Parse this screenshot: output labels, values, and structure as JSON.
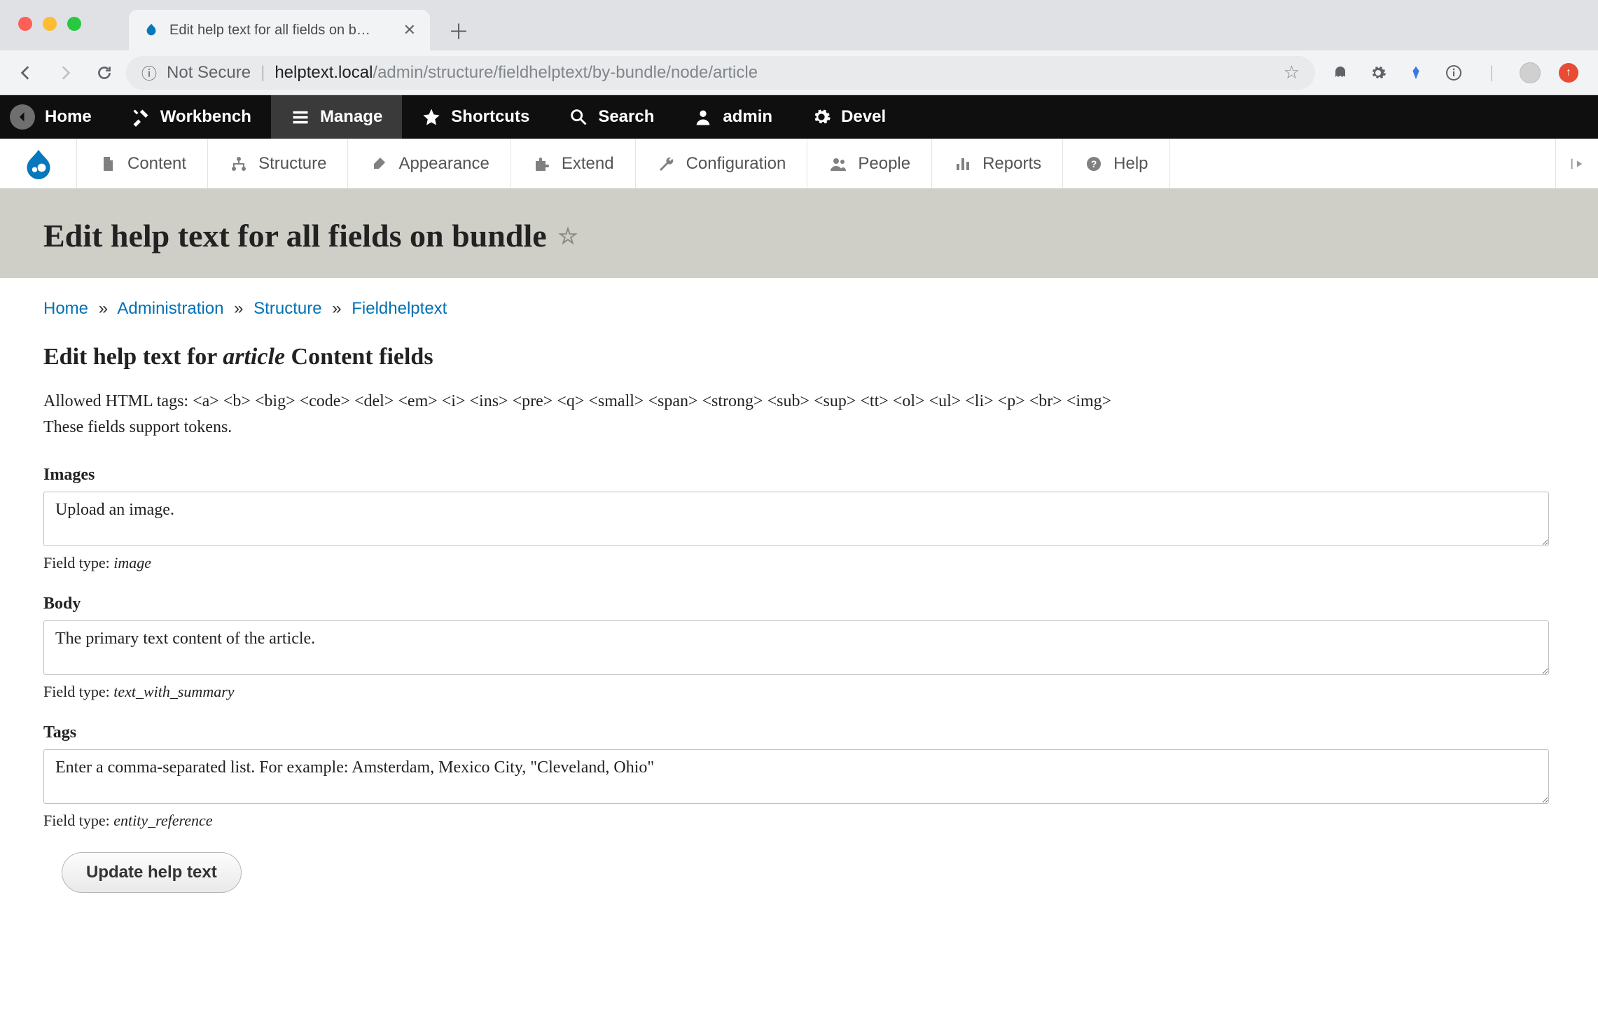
{
  "browser": {
    "tab_title": "Edit help text for all fields on b…",
    "not_secure_label": "Not Secure",
    "url_host": "helptext.local",
    "url_path": "/admin/structure/fieldhelptext/by-bundle/node/article"
  },
  "black_bar": {
    "home": "Home",
    "workbench": "Workbench",
    "manage": "Manage",
    "shortcuts": "Shortcuts",
    "search": "Search",
    "user": "admin",
    "devel": "Devel"
  },
  "white_bar": {
    "content": "Content",
    "structure": "Structure",
    "appearance": "Appearance",
    "extend": "Extend",
    "configuration": "Configuration",
    "people": "People",
    "reports": "Reports",
    "help": "Help"
  },
  "page_title": "Edit help text for all fields on bundle",
  "breadcrumb": {
    "home": "Home",
    "administration": "Administration",
    "structure": "Structure",
    "fieldhelptext": "Fieldhelptext"
  },
  "subheading": {
    "prefix": "Edit help text for ",
    "em": "article",
    "suffix": " Content fields"
  },
  "intro": {
    "line1": "Allowed HTML tags: <a> <b> <big> <code> <del> <em> <i> <ins> <pre> <q> <small> <span> <strong> <sub> <sup> <tt> <ol> <ul> <li> <p> <br> <img>",
    "line2": "These fields support tokens."
  },
  "fields": [
    {
      "label": "Images",
      "value": "Upload an image.",
      "type_label": "Field type: ",
      "type": "image"
    },
    {
      "label": "Body",
      "value": "The primary text content of the article.",
      "type_label": "Field type: ",
      "type": "text_with_summary"
    },
    {
      "label": "Tags",
      "value": "Enter a comma-separated list. For example: Amsterdam, Mexico City, \"Cleveland, Ohio\"",
      "type_label": "Field type: ",
      "type": "entity_reference"
    }
  ],
  "submit_label": "Update help text"
}
